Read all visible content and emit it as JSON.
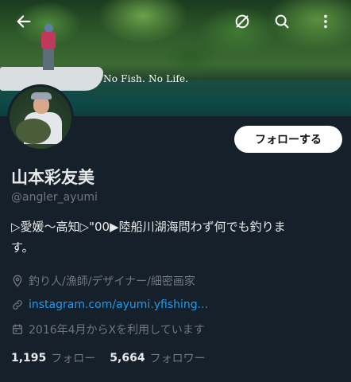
{
  "banner": {
    "tagline": "No Fish. No Life."
  },
  "header": {
    "icons": [
      "back-arrow-icon",
      "cancel-icon",
      "search-icon",
      "more-vertical-icon"
    ]
  },
  "profile": {
    "follow_label": "フォローする",
    "name": "山本彩友美",
    "handle": "@angler_ayumi",
    "bio_line1": "▷愛媛〜高知▷\"00▶陸船川湖海問わず何でも釣りま",
    "bio_line2": "す。",
    "location": "釣り人/漁師/デザイナー/細密画家",
    "link": "instagram.com/ayumi.yfishing...",
    "joined": "2016年4月からXを利用しています",
    "following_count": "1,195",
    "following_label": "フォロー",
    "followers_count": "5,664",
    "followers_label": "フォロワー"
  },
  "colors": {
    "background": "#15202b",
    "link": "#1d9bf0",
    "secondary_text": "#71767b",
    "primary_text": "#e7e9ea"
  }
}
